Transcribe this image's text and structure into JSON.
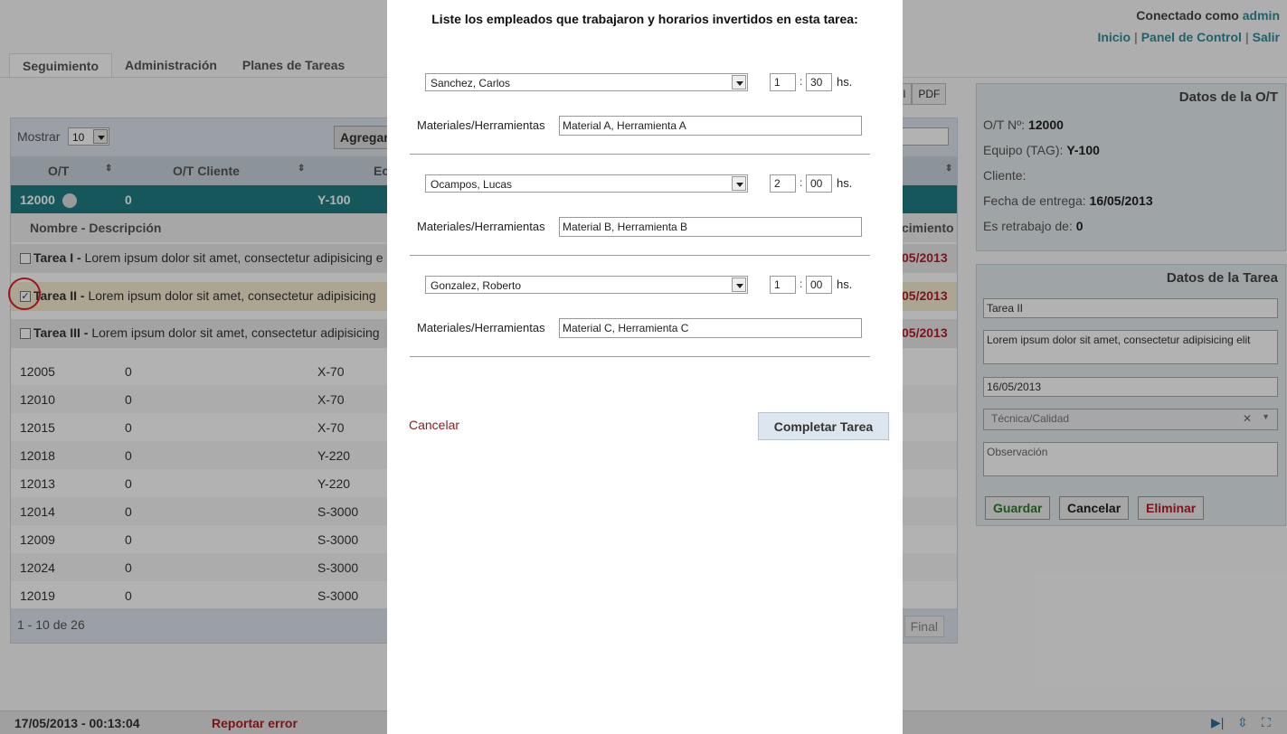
{
  "header": {
    "connected_prefix": "Conectado como",
    "user": "admin",
    "links": [
      "Inicio",
      "Panel de Control",
      "Salir"
    ],
    "sep": "|"
  },
  "tabs": [
    "Seguimiento",
    "Administración",
    "Planes de Tareas"
  ],
  "export_buttons": [
    "el",
    "PDF"
  ],
  "grid": {
    "show_label": "Mostrar",
    "show_value": "10",
    "add_button": "Agregar",
    "columns": [
      "O/T",
      "O/T Cliente",
      "Ec"
    ],
    "last_col_fragment": "cimiento",
    "selected_row": {
      "ot": "12000",
      "client": "0",
      "equip": "Y-100"
    },
    "subheader": "Nombre - Descripción",
    "tasks": [
      {
        "name": "Tarea I -",
        "desc": "Lorem ipsum dolor sit amet, consectetur adipisicing e",
        "date": "05/2013",
        "checked": ""
      },
      {
        "name": "Tarea II -",
        "desc": "Lorem ipsum dolor sit amet, consectetur adipisicing",
        "date": "05/2013",
        "checked": "✓"
      },
      {
        "name": "Tarea III -",
        "desc": "Lorem ipsum dolor sit amet, consectetur adipisicing",
        "date": "05/2013",
        "checked": ""
      }
    ],
    "rows": [
      {
        "ot": "12005",
        "client": "0",
        "equip": "X-70"
      },
      {
        "ot": "12010",
        "client": "0",
        "equip": "X-70"
      },
      {
        "ot": "12015",
        "client": "0",
        "equip": "X-70"
      },
      {
        "ot": "12018",
        "client": "0",
        "equip": "Y-220"
      },
      {
        "ot": "12013",
        "client": "0",
        "equip": "Y-220"
      },
      {
        "ot": "12014",
        "client": "0",
        "equip": "S-3000"
      },
      {
        "ot": "12009",
        "client": "0",
        "equip": "S-3000"
      },
      {
        "ot": "12024",
        "client": "0",
        "equip": "S-3000"
      },
      {
        "ot": "12019",
        "client": "0",
        "equip": "S-3000"
      }
    ],
    "pager_info": "1 - 10 de 26",
    "final_button": "Final"
  },
  "ot_panel": {
    "title": "Datos de la O/T",
    "fields": [
      {
        "label": "O/T Nº:",
        "value": "12000"
      },
      {
        "label": "Equipo (TAG):",
        "value": "Y-100"
      },
      {
        "label": "Cliente:",
        "value": ""
      },
      {
        "label": "Fecha de entrega:",
        "value": "16/05/2013"
      },
      {
        "label": "Es retrabajo de:",
        "value": "0"
      }
    ]
  },
  "task_panel": {
    "title": "Datos de la Tarea",
    "name": "Tarea II",
    "description": "Lorem ipsum dolor sit amet, consectetur adipisicing elit",
    "date": "16/05/2013",
    "category": "Técnica/Calidad",
    "observation_placeholder": "Observación",
    "buttons": {
      "save": "Guardar",
      "cancel": "Cancelar",
      "delete": "Eliminar"
    }
  },
  "footer": {
    "datetime": "17/05/2013 - 00:13:04",
    "report": "Reportar error"
  },
  "modal": {
    "title": "Liste los empleados que trabajaron y horarios invertidos en esta tarea:",
    "materials_label": "Materiales/Herramientas",
    "hs_label": "hs.",
    "colon": ":",
    "employees": [
      {
        "name": "Sanchez, Carlos",
        "hours": "1",
        "minutes": "30",
        "materials": "Material A, Herramienta A"
      },
      {
        "name": "Ocampos, Lucas",
        "hours": "2",
        "minutes": "00",
        "materials": "Material B, Herramienta B"
      },
      {
        "name": "Gonzalez, Roberto",
        "hours": "1",
        "minutes": "00",
        "materials": "Material C, Herramienta C"
      }
    ],
    "cancel": "Cancelar",
    "complete": "Completar Tarea"
  },
  "colors": {
    "accent": "#2a8f9a",
    "selected_row": "#1f7d81",
    "danger": "#b0202a",
    "overlay": "rgba(0,0,0,0.3)"
  }
}
